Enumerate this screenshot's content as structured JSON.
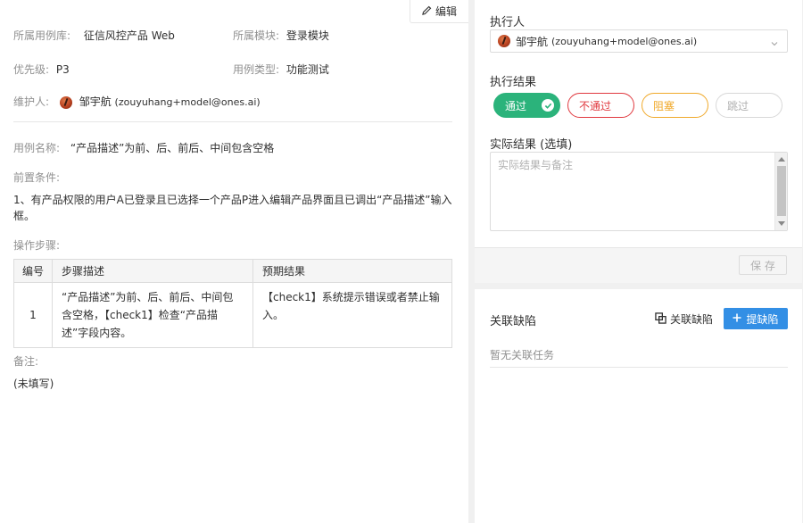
{
  "left": {
    "edit_label": "编辑",
    "library_label": "所属用例库:",
    "library_value": "征信风控产品 Web",
    "module_label": "所属模块:",
    "module_value": "登录模块",
    "priority_label": "优先级:",
    "priority_value": "P3",
    "type_label": "用例类型:",
    "type_value": "功能测试",
    "maintainer_label": "维护人:",
    "maintainer_name": "邹宇航",
    "maintainer_email": "(zouyuhang+model@ones.ai)",
    "case_name_label": "用例名称:",
    "case_name_value": "“产品描述”为前、后、前后、中间包含空格",
    "precondition_label": "前置条件:",
    "precondition_value": "1、有产品权限的用户A已登录且已选择一个产品P进入编辑产品界面且已调出“产品描述”输入框。",
    "steps_label": "操作步骤:",
    "steps_headers": [
      "编号",
      "步骤描述",
      "预期结果"
    ],
    "steps": [
      {
        "num": "1",
        "desc": "“产品描述”为前、后、前后、中间包含空格，【check1】检查“产品描述”字段内容。",
        "expected": "【check1】系统提示错误或者禁止输入。"
      }
    ],
    "remark_label": "备注:",
    "remark_value": "(未填写)"
  },
  "right": {
    "executor_label": "执行人",
    "executor_name": "邹宇航",
    "executor_email": "(zouyuhang+model@ones.ai)",
    "result_label": "执行结果",
    "result_options": [
      "通过",
      "不通过",
      "阻塞",
      "跳过"
    ],
    "selected_result": "通过",
    "actual_label": "实际结果 (选填)",
    "actual_placeholder": "实际结果与备注",
    "save_label": "保 存",
    "defects_label": "关联缺陷",
    "link_defect_label": "关联缺陷",
    "add_defect_label": "提缺陷",
    "empty_text": "暂无关联任务"
  },
  "colors": {
    "pass": "#2bb37b",
    "fail": "#e0383e",
    "block": "#f0a92a",
    "primary": "#338fe5"
  }
}
